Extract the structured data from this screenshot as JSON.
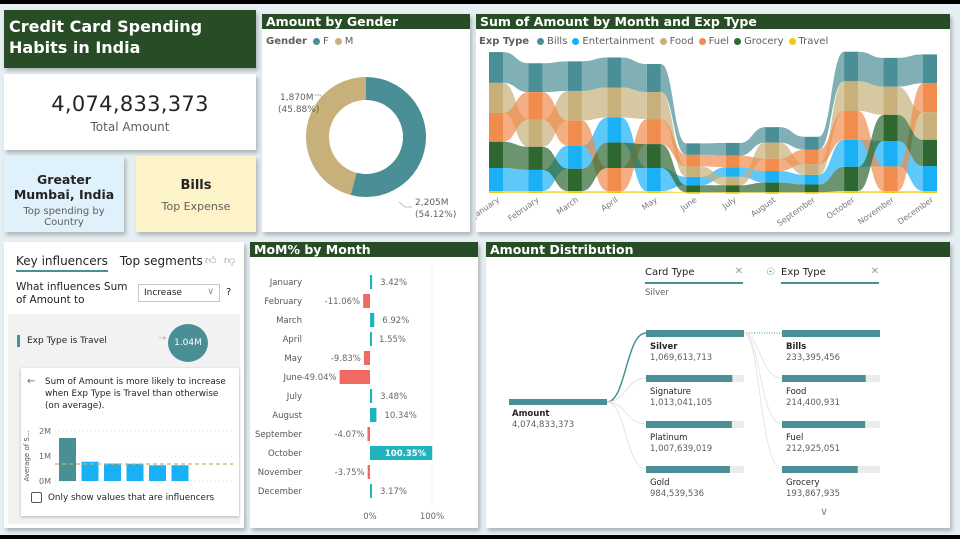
{
  "title": "Credit Card Spending Habits in India",
  "kpi": {
    "value": "4,074,833,373",
    "label": "Total Amount"
  },
  "top_country": {
    "value": "Greater Mumbai, India",
    "label": "Top spending by Country"
  },
  "top_expense": {
    "value": "Bills",
    "label": "Top Expense"
  },
  "colors": {
    "header": "#284d26",
    "bills": "#4a8f95",
    "entertainment": "#1ab0f5",
    "food": "#c7b07a",
    "fuel": "#f08c4c",
    "grocery": "#2e6730",
    "travel": "#f2c80f",
    "positive": "#1fb3bd",
    "negative": "#ef6a62",
    "accent": "#4a8f95"
  },
  "gender": {
    "title": "Amount by Gender",
    "legend_title": "Gender",
    "chart_data": {
      "type": "pie",
      "title": "Amount by Gender",
      "legend": "top-left",
      "slices": [
        {
          "label": "F",
          "value": 2205,
          "unit": "M",
          "display": "2,205M",
          "pct": "(54.12%)",
          "color": "#4a8f95"
        },
        {
          "label": "M",
          "value": 1870,
          "unit": "M",
          "display": "1,870M",
          "pct": "(45.88%)",
          "color": "#c7b07a"
        }
      ]
    }
  },
  "ribbon": {
    "title": "Sum of Amount by Month and Exp Type",
    "legend_title": "Exp Type",
    "chart_data": {
      "type": "area",
      "subtype": "ribbon",
      "title": "Sum of Amount by Month and Exp Type",
      "legend": "top-left",
      "categories": [
        "January",
        "February",
        "March",
        "April",
        "May",
        "June",
        "July",
        "August",
        "September",
        "October",
        "November",
        "December"
      ],
      "series_order_top_to_bottom": [
        [
          "Bills",
          "Food",
          "Fuel",
          "Grocery",
          "Entertainment",
          "Travel"
        ],
        [
          "Bills",
          "Fuel",
          "Food",
          "Grocery",
          "Entertainment",
          "Travel"
        ],
        [
          "Bills",
          "Food",
          "Fuel",
          "Entertainment",
          "Grocery",
          "Travel"
        ],
        [
          "Bills",
          "Food",
          "Entertainment",
          "Grocery",
          "Fuel",
          "Travel"
        ],
        [
          "Bills",
          "Food",
          "Fuel",
          "Grocery",
          "Entertainment",
          "Travel"
        ],
        [
          "Bills",
          "Fuel",
          "Food",
          "Entertainment",
          "Grocery",
          "Travel"
        ],
        [
          "Bills",
          "Fuel",
          "Entertainment",
          "Food",
          "Grocery",
          "Travel"
        ],
        [
          "Bills",
          "Food",
          "Fuel",
          "Entertainment",
          "Grocery",
          "Travel"
        ],
        [
          "Bills",
          "Fuel",
          "Food",
          "Entertainment",
          "Grocery",
          "Travel"
        ],
        [
          "Bills",
          "Food",
          "Fuel",
          "Entertainment",
          "Grocery",
          "Travel"
        ],
        [
          "Bills",
          "Food",
          "Grocery",
          "Entertainment",
          "Fuel",
          "Travel"
        ],
        [
          "Bills",
          "Fuel",
          "Food",
          "Grocery",
          "Entertainment",
          "Travel"
        ]
      ],
      "series": [
        {
          "name": "Bills",
          "color": "#4a8f95",
          "values": [
            80,
            75,
            77,
            78,
            73,
            30,
            33,
            40,
            33,
            77,
            75,
            75
          ]
        },
        {
          "name": "Entertainment",
          "color": "#1ab0f5",
          "values": [
            60,
            55,
            60,
            65,
            60,
            22,
            25,
            30,
            25,
            70,
            66,
            65
          ]
        },
        {
          "name": "Food",
          "color": "#c7b07a",
          "values": [
            78,
            70,
            77,
            78,
            70,
            27,
            22,
            42,
            28,
            77,
            73,
            72
          ]
        },
        {
          "name": "Fuel",
          "color": "#f08c4c",
          "values": [
            75,
            72,
            65,
            60,
            65,
            30,
            30,
            32,
            38,
            75,
            64,
            75
          ]
        },
        {
          "name": "Grocery",
          "color": "#2e6730",
          "values": [
            68,
            60,
            58,
            66,
            62,
            18,
            18,
            25,
            20,
            63,
            68,
            68
          ]
        },
        {
          "name": "Travel",
          "color": "#f2c80f",
          "values": [
            5,
            5,
            5,
            5,
            5,
            2,
            2,
            2,
            2,
            5,
            5,
            5
          ]
        }
      ],
      "value_unit": "M (estimated)"
    }
  },
  "influencers": {
    "tabs": [
      "Key influencers",
      "Top segments"
    ],
    "question": "What influences Sum of Amount to",
    "dropdown_value": "Increase",
    "help": "?",
    "factor_label": "Exp Type is Travel",
    "factor_value": "1.04M",
    "explanation": "Sum of Amount is more likely to increase when Exp Type is Travel than otherwise (on average).",
    "checkbox_label": "Only show values that are influencers",
    "chart_data": {
      "type": "bar",
      "ylabel": "Average of S...",
      "yticks": [
        "2M",
        "1M",
        "0M"
      ],
      "ylim": [
        0,
        2.1
      ],
      "values": [
        1.72,
        0.77,
        0.7,
        0.69,
        0.63,
        0.63
      ],
      "average_line": 0.68,
      "highlight_index": 0
    }
  },
  "mom": {
    "title": "MoM% by Month",
    "chart_data": {
      "type": "bar",
      "orientation": "horizontal",
      "title": "MoM% by Month",
      "categories": [
        "January",
        "February",
        "March",
        "April",
        "May",
        "June",
        "July",
        "August",
        "September",
        "October",
        "November",
        "December"
      ],
      "values": [
        3.42,
        -11.06,
        6.92,
        1.55,
        -9.83,
        -49.04,
        3.48,
        10.34,
        -4.07,
        100.35,
        -3.75,
        3.17
      ],
      "labels": [
        "3.42%",
        "-11.06%",
        "6.92%",
        "1.55%",
        "-9.83%",
        "-49.04%",
        "3.48%",
        "10.34%",
        "-4.07%",
        "100.35%",
        "-3.75%",
        "3.17%"
      ],
      "xticks": [
        "0%",
        "100%"
      ],
      "xlim": [
        -60,
        100
      ]
    }
  },
  "distribution": {
    "title": "Amount Distribution",
    "level1_header": "Card Type",
    "level1_filter": "Silver",
    "level2_header": "Exp Type",
    "root": {
      "label": "Amount",
      "value": "4,074,833,373"
    },
    "chart_data": {
      "type": "bar",
      "subtype": "decomposition-tree",
      "level1": [
        {
          "label": "Silver",
          "value": 1069613713,
          "display": "1,069,613,713",
          "selected": true
        },
        {
          "label": "Signature",
          "value": 1013041105,
          "display": "1,013,041,105"
        },
        {
          "label": "Platinum",
          "value": 1007639019,
          "display": "1,007,639,019"
        },
        {
          "label": "Gold",
          "value": 984539536,
          "display": "984,539,536"
        }
      ],
      "level2": [
        {
          "label": "Bills",
          "value": 233395456,
          "display": "233,395,456",
          "selected": true
        },
        {
          "label": "Food",
          "value": 214400931,
          "display": "214,400,931"
        },
        {
          "label": "Fuel",
          "value": 212925051,
          "display": "212,925,051"
        },
        {
          "label": "Grocery",
          "value": 193867935,
          "display": "193,867,935"
        }
      ]
    }
  }
}
